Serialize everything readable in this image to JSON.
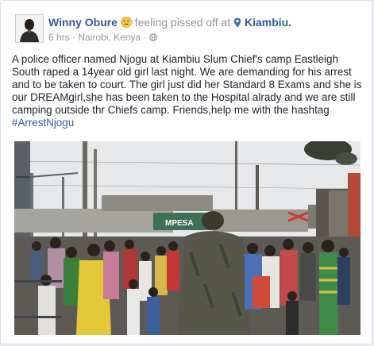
{
  "post": {
    "author": "Winny Obure",
    "feeling_text": "feeling pissed off at",
    "location": "Kiambiu.",
    "time": "6 hrs",
    "sep": "·",
    "place_meta": "Nairobi, Kenya",
    "sep2": "·",
    "body": "A police officer named Njogu at Kiambiu Slum Chief's camp Eastleigh South raped a 14year old girl last night. We are demanding for his arrest and to be taken to court. The girl just did her Standard 8 Exams and she is our DREAMgirl,she has been taken to the Hospital alrady and we are still camping outside thr Chiefs camp. Friends,help me with the hashtag",
    "hashtag": "#ArrestNjogu",
    "sign_text": "MPESA"
  },
  "icons": {
    "emoji": "angry-face-icon",
    "location": "map-pin-icon",
    "privacy": "globe-icon"
  },
  "colors": {
    "link": "#365899",
    "text": "#1d2129",
    "meta": "#90949c"
  }
}
